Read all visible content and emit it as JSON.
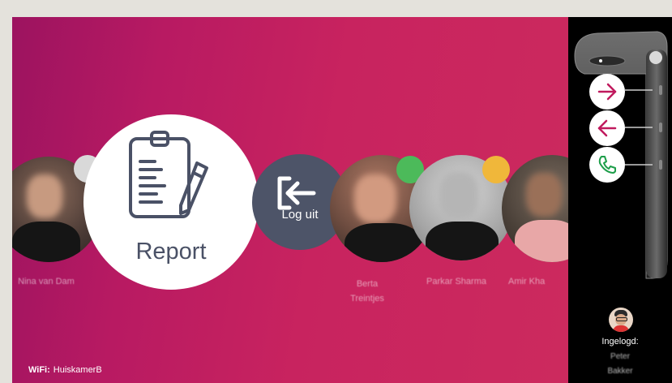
{
  "carousel": {
    "report_label": "Report",
    "logout_label": "Log uit",
    "contacts": [
      {
        "name": "Nina van Dam"
      },
      {
        "name": "Berta Treintjes",
        "status_color": "#4cba5a"
      },
      {
        "name": "Parkar Sharma",
        "status_color": "#f0b73a"
      },
      {
        "name": "Amir Kha"
      }
    ]
  },
  "footer": {
    "wifi_label": "WiFi:",
    "wifi_network": "HuiskamerB"
  },
  "side_panel": {
    "logged_in_label": "Ingelogd:",
    "logged_in_user": "Peter Bakker",
    "buttons": [
      "next-icon",
      "previous-icon",
      "phone-icon"
    ]
  },
  "colors": {
    "accent": "#c01a5e",
    "tile_dark": "#4d5468",
    "icon_gray": "#4a5166",
    "call_green": "#1e9e4a"
  }
}
